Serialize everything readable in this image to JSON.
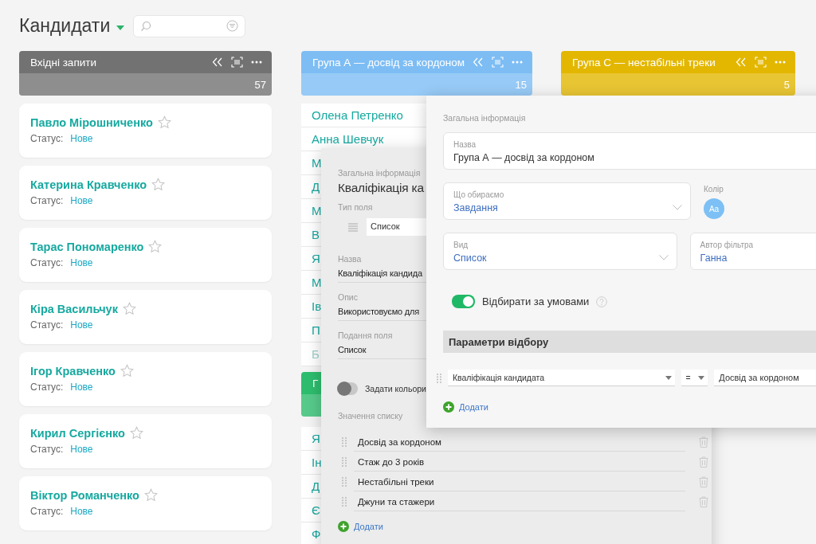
{
  "title": "Кандидати",
  "columns": [
    {
      "kind": "cards",
      "title": "Вхідні запити",
      "count": "57",
      "color": "#727272",
      "cards": [
        {
          "name": "Павло Мірошниченко",
          "status_label": "Статус:",
          "status": "Нове",
          "starred": false
        },
        {
          "name": "Катерина Кравченко",
          "status_label": "Статус:",
          "status": "Нове",
          "starred": false
        },
        {
          "name": "Тарас Пономаренко",
          "status_label": "Статус:",
          "status": "Нове",
          "starred": false
        },
        {
          "name": "Кіра Васильчук",
          "status_label": "Статус:",
          "status": "Нове",
          "starred": false
        },
        {
          "name": "Ігор Кравченко",
          "status_label": "Статус:",
          "status": "Нове",
          "starred": false
        },
        {
          "name": "Кирил Сергієнко",
          "status_label": "Статус:",
          "status": "Нове",
          "starred": false
        },
        {
          "name": "Віктор Романченко",
          "status_label": "Статус:",
          "status": "Нове",
          "starred": false
        }
      ]
    },
    {
      "kind": "list",
      "title": "Група А — досвід за кордоном",
      "count": "15",
      "color": "#7dbdf4",
      "rows": [
        "Олена Петренко",
        "Анна Шевчук",
        "М",
        "Д",
        "М",
        "В",
        "Я",
        "М",
        "Ів",
        "П",
        "Б"
      ],
      "subgroup": {
        "title": "Г",
        "color": "#2ebd6e",
        "rows": [
          "Я",
          "Ін",
          "Д",
          "Є",
          "Ф"
        ]
      }
    },
    {
      "kind": "list",
      "title": "Група С — нестабільні треки",
      "count": "5",
      "color": "#e3b700"
    }
  ],
  "field_dialog": {
    "section": "Загальна інформація",
    "title": "Кваліфікація ка",
    "type_label": "Тип поля",
    "type_value": "Список",
    "name_label": "Назва",
    "name_value": "Кваліфікація кандида",
    "description_label": "Опис",
    "description_value": "Використовуємо для",
    "view_label": "Подання поля",
    "view_value": "Список",
    "colors_toggle": {
      "label": "Задати кольори",
      "on": false
    },
    "values_label": "Значення списку",
    "values": [
      "Досвід за кордоном",
      "Стаж до 3 років",
      "Нестабільні треки",
      "Джуни та стажери"
    ],
    "add": "Додати"
  },
  "filter_dialog": {
    "section": "Загальна інформація",
    "name": {
      "label": "Назва",
      "value": "Група А — досвід за кордоном"
    },
    "target": {
      "label": "Що обираємо",
      "value": "Завдання"
    },
    "color": {
      "label": "Колір",
      "badge": "Aa"
    },
    "view": {
      "label": "Вид",
      "value": "Список"
    },
    "author": {
      "label": "Автор фільтра",
      "value": "Ганна"
    },
    "conditions_toggle": {
      "label": "Відбирати за умовами",
      "on": true
    },
    "params_title": "Параметри відбору",
    "conditions": [
      {
        "field": "Кваліфікація кандидата",
        "operator": "=",
        "value": "Досвід за кордоном"
      }
    ],
    "add": "Додати"
  }
}
